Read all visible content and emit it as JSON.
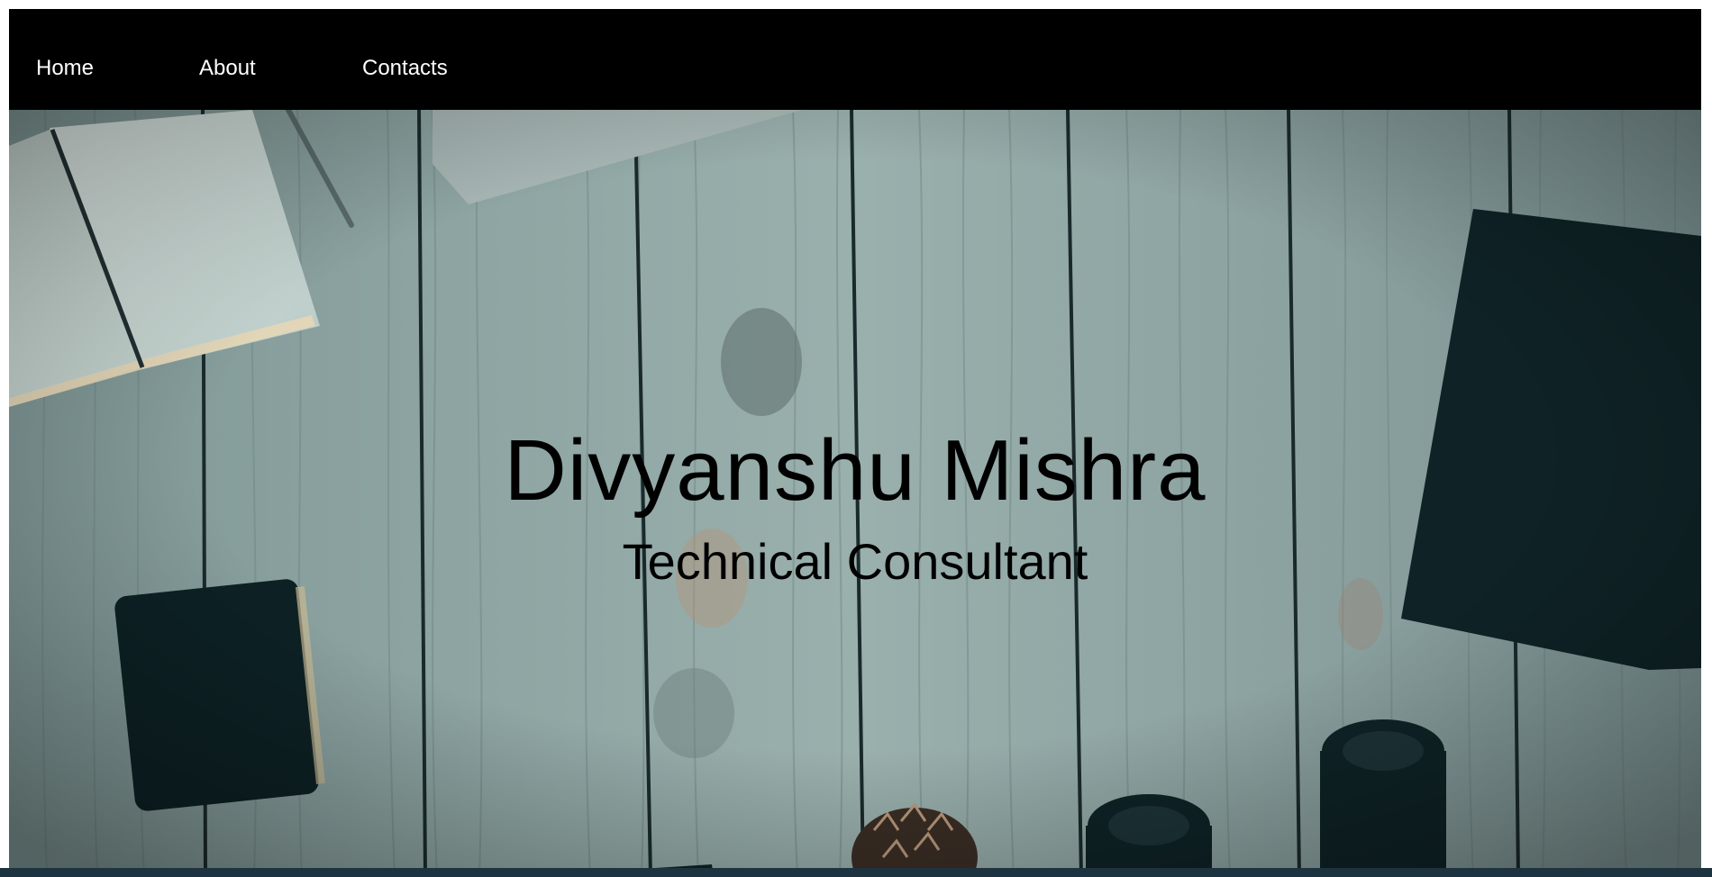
{
  "nav": {
    "items": [
      {
        "label": "Home"
      },
      {
        "label": "About"
      },
      {
        "label": "Contacts"
      }
    ]
  },
  "hero": {
    "name": "Divyanshu Mishra",
    "role": "Technical Consultant",
    "background_image": "wooden-desk-flatlay",
    "colors": {
      "nav_bg": "#000000",
      "nav_text": "#ffffff",
      "wood": "#8da4a4",
      "dark_objects": "#0f2326"
    }
  }
}
